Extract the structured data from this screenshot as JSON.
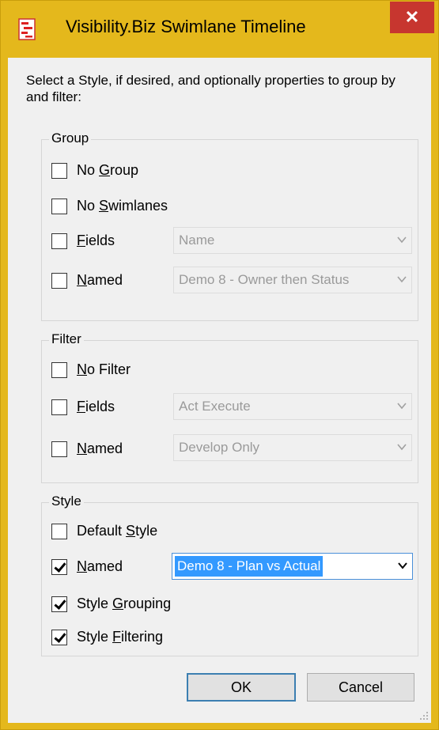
{
  "window": {
    "title": "Visibility.Biz Swimlane Timeline",
    "close_glyph": "✕",
    "icon": "app-icon"
  },
  "intro": {
    "text": "Select a Style, if desired, and optionally properties to group by and filter:"
  },
  "group": {
    "legend": "Group",
    "no_group": {
      "label_pre": "No ",
      "label_u": "G",
      "label_post": "roup",
      "checked": false
    },
    "no_swimlanes": {
      "label_pre": "No ",
      "label_u": "S",
      "label_post": "wimlanes",
      "checked": false
    },
    "fields": {
      "label_pre": "",
      "label_u": "F",
      "label_post": "ields",
      "checked": false,
      "value": "Name"
    },
    "named": {
      "label_pre": "",
      "label_u": "N",
      "label_post": "amed",
      "checked": false,
      "value": "Demo 8 - Owner then Status"
    }
  },
  "filter": {
    "legend": "Filter",
    "no_filter": {
      "label_pre": "",
      "label_u": "N",
      "label_post": "o Filter",
      "checked": false
    },
    "fields": {
      "label_pre": "",
      "label_u": "F",
      "label_post": "ields",
      "checked": false,
      "value": "Act Execute"
    },
    "named": {
      "label_pre": "",
      "label_u": "N",
      "label_post": "amed",
      "checked": false,
      "value": "Develop Only"
    }
  },
  "style": {
    "legend": "Style",
    "default_style": {
      "label_pre": "Default ",
      "label_u": "S",
      "label_post": "tyle",
      "checked": false
    },
    "named": {
      "label_pre": "",
      "label_u": "N",
      "label_post": "amed",
      "checked": true,
      "value": "Demo 8 - Plan vs Actual"
    },
    "style_grouping": {
      "label_pre": "Style ",
      "label_u": "G",
      "label_post": "rouping",
      "checked": true
    },
    "style_filtering": {
      "label_pre": "Style ",
      "label_u": "F",
      "label_post": "iltering",
      "checked": true
    }
  },
  "buttons": {
    "ok": "OK",
    "cancel": "Cancel"
  },
  "colors": {
    "frame": "#e4b81c",
    "close": "#c7362f",
    "selection": "#3399ff"
  }
}
